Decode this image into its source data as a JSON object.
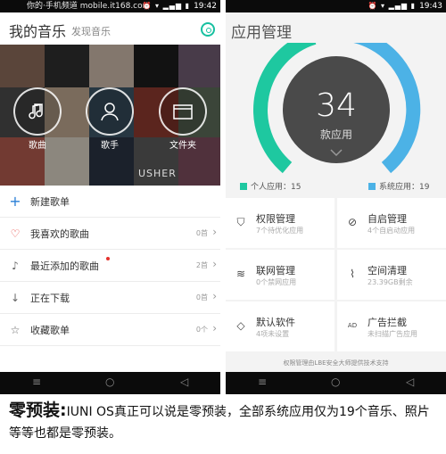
{
  "watermark": "你的·手机频道 mobile.it168.com",
  "left": {
    "time": "19:42",
    "title": "我的音乐",
    "discover": "发现音乐",
    "cover_text": "USHER",
    "buttons": [
      {
        "label": "歌曲"
      },
      {
        "label": "歌手"
      },
      {
        "label": "文件夹"
      }
    ],
    "rows": [
      {
        "icon": "+",
        "label": "新建歌单",
        "count": ""
      },
      {
        "icon": "♡",
        "label": "我喜欢的歌曲",
        "count": "0首"
      },
      {
        "icon": "♪",
        "label": "最近添加的歌曲",
        "count": "2首"
      },
      {
        "icon": "↓",
        "label": "正在下载",
        "count": "0首"
      },
      {
        "icon": "☆",
        "label": "收藏歌单",
        "count": "0个"
      }
    ]
  },
  "right": {
    "time": "19:43",
    "title": "应用管理",
    "count": "34",
    "count_label": "款应用",
    "legend_personal": "个人应用：15",
    "legend_system": "系统应用：19",
    "colors": {
      "personal": "#1ec8a0",
      "system": "#4cb2e6"
    },
    "tiles": [
      {
        "title": "权限管理",
        "sub": "7个待优化应用"
      },
      {
        "title": "自启管理",
        "sub": "4个自启动应用"
      },
      {
        "title": "联网管理",
        "sub": "0个禁网应用"
      },
      {
        "title": "空间清理",
        "sub": "23.39GB剩余"
      },
      {
        "title": "默认软件",
        "sub": "4项未设置"
      },
      {
        "title": "广告拦截",
        "sub": "未扫描广告应用"
      }
    ],
    "footer": "权限管理由LBE安全大师提供技术支持"
  },
  "caption": {
    "bold": "零预装:",
    "text": "IUNI OS真正可以说是零预装，全部系统应用仅为19个音乐、照片等等也都是零预装。"
  }
}
